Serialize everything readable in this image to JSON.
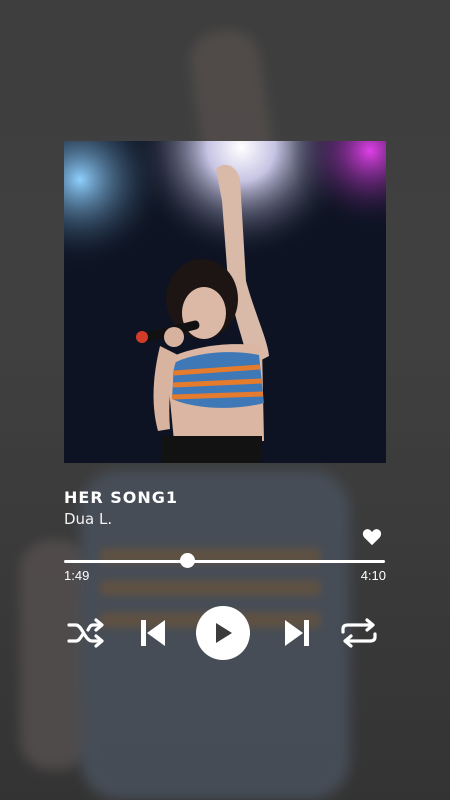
{
  "track": {
    "title": "HER SONG1",
    "artist": "Dua L.",
    "current_time": "1:49",
    "total_time": "4:10",
    "progress_fraction": 0.382,
    "liked": true
  },
  "controls": {
    "shuffle_icon": "shuffle-icon",
    "previous_icon": "skip-previous-icon",
    "play_icon": "play-icon",
    "next_icon": "skip-next-icon",
    "repeat_icon": "repeat-icon",
    "like_icon": "heart-icon"
  },
  "colors": {
    "foreground": "#ffffff",
    "play_glyph": "#3c3c3c"
  }
}
